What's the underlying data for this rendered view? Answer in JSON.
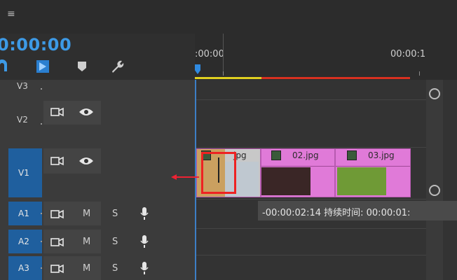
{
  "menu": {
    "icon": "hamburger-icon",
    "glyph": "≡"
  },
  "timecode": "0:00:00",
  "tools": [
    {
      "name": "magnet-snap-icon"
    },
    {
      "name": "linked-selection-icon"
    },
    {
      "name": "add-marker-icon"
    },
    {
      "name": "wrench-settings-icon"
    }
  ],
  "ruler": {
    "start_label": ":00:00",
    "end_label": "00:00:1"
  },
  "tracks": {
    "video": [
      {
        "label": "V3"
      },
      {
        "label": "V2"
      },
      {
        "label": "V1"
      }
    ],
    "audio": [
      {
        "label": "A1",
        "m": "M",
        "s": "S"
      },
      {
        "label": "A2",
        "m": "M",
        "s": "S"
      },
      {
        "label": "A3",
        "m": "M",
        "s": "S"
      }
    ]
  },
  "clips": [
    {
      "label": "01.jpg",
      "short": "jpg"
    },
    {
      "label": "02.jpg"
    },
    {
      "label": "03.jpg"
    }
  ],
  "tooltip": "-00:00:02:14 持续时间: 00:00:01:",
  "colors": {
    "accent": "#3d9ae6",
    "clip": "#e07ad8",
    "track_active": "#1f5f9e",
    "work_yellow": "#e0d020",
    "work_red": "#d83020"
  }
}
